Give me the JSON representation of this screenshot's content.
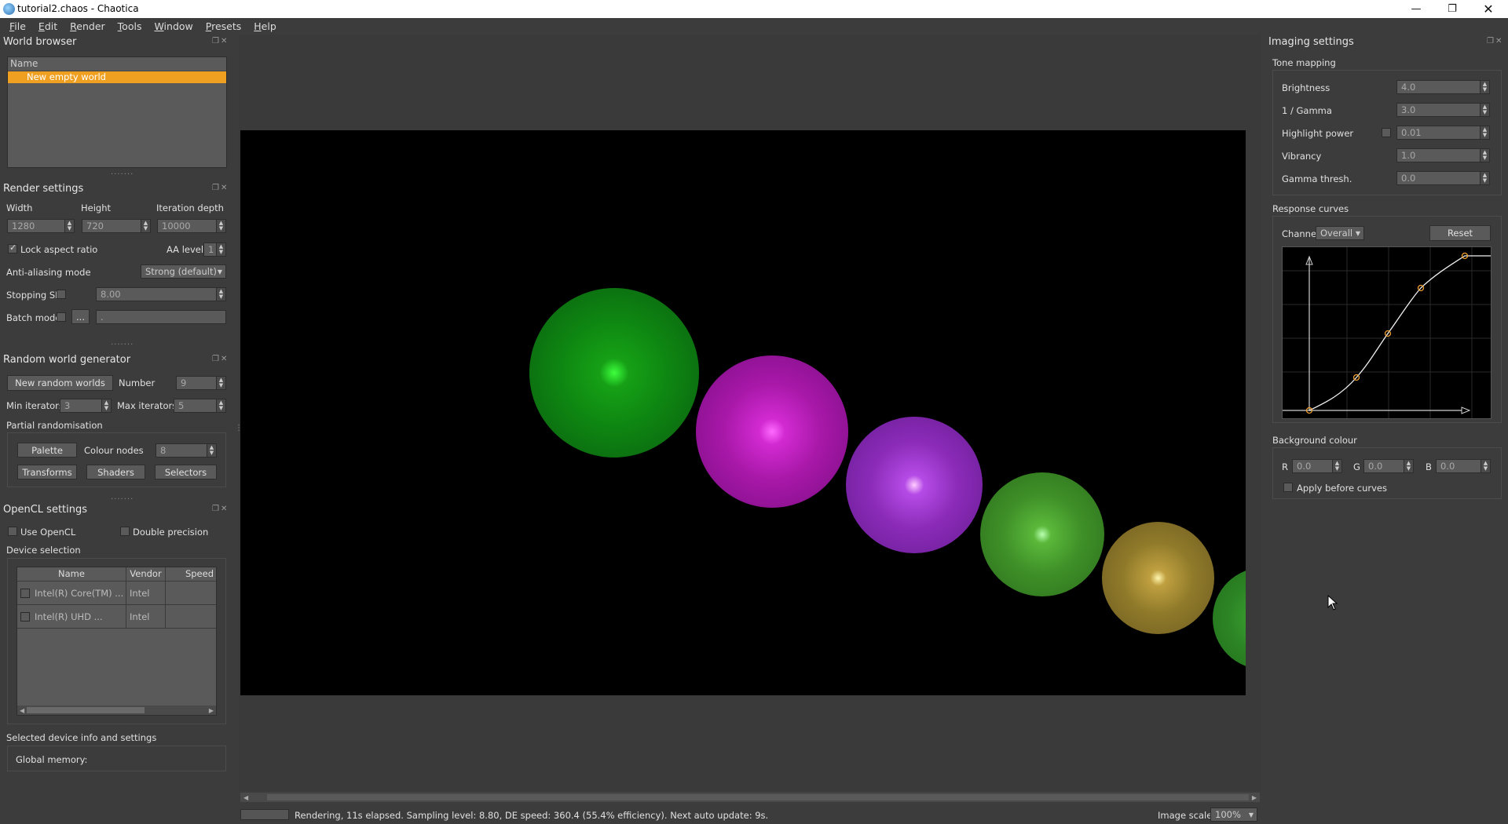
{
  "window": {
    "title": "tutorial2.chaos - Chaotica",
    "minimize_icon": "minimize-icon",
    "maximize_icon": "restore-icon",
    "close_icon": "close-icon"
  },
  "menu": [
    "File",
    "Edit",
    "Render",
    "Tools",
    "Window",
    "Presets",
    "Help"
  ],
  "world_browser": {
    "title": "World browser",
    "column_name": "Name",
    "items": [
      "New empty world"
    ],
    "selected_color": "#f0a020"
  },
  "render_settings": {
    "title": "Render settings",
    "width_label": "Width",
    "height_label": "Height",
    "iteration_depth_label": "Iteration depth",
    "width": "1280",
    "height": "720",
    "iteration_depth": "10000",
    "lock_aspect_label": "Lock aspect ratio",
    "lock_aspect_checked": true,
    "aa_level_label": "AA level",
    "aa_level": "1",
    "anti_aliasing_label": "Anti-aliasing mode",
    "anti_aliasing_value": "Strong (default)",
    "stopping_sl_label": "Stopping SL",
    "stopping_sl_value": "8.00",
    "batch_mode_label": "Batch mode",
    "batch_browse": "...",
    "batch_path": "."
  },
  "random_world": {
    "title": "Random world generator",
    "new_button": "New random worlds",
    "number_label": "Number",
    "number": "9",
    "min_iter_label": "Min iterators",
    "min_iter": "3",
    "max_iter_label": "Max iterators",
    "max_iter": "5",
    "partial_label": "Partial randomisation",
    "palette_button": "Palette",
    "colour_nodes_label": "Colour nodes",
    "colour_nodes": "8",
    "transforms_button": "Transforms",
    "shaders_button": "Shaders",
    "selectors_button": "Selectors"
  },
  "opencl": {
    "title": "OpenCL settings",
    "use_opencl": "Use OpenCL",
    "double_precision": "Double precision",
    "device_selection": "Device selection",
    "columns": [
      "Name",
      "Vendor",
      "Speed"
    ],
    "devices": [
      {
        "name": "Intel(R) Core(TM) ...",
        "vendor": "Intel",
        "speed": ""
      },
      {
        "name": "Intel(R) UHD ...",
        "vendor": "Intel",
        "speed": ""
      }
    ],
    "selected_info": "Selected device info and settings",
    "global_memory": "Global memory:"
  },
  "imaging": {
    "title": "Imaging settings",
    "tone_mapping": "Tone mapping",
    "brightness_label": "Brightness",
    "brightness": "4.0",
    "gamma_label": "1 / Gamma",
    "gamma": "3.0",
    "highlight_label": "Highlight power",
    "highlight": "0.01",
    "vibrancy_label": "Vibrancy",
    "vibrancy": "1.0",
    "gamma_thresh_label": "Gamma thresh.",
    "gamma_thresh": "0.0",
    "response_curves": "Response curves",
    "channel_label": "Channel:",
    "channel_value": "Overall",
    "reset_button": "Reset",
    "background_colour": "Background colour",
    "r_label": "R",
    "r": "0.0",
    "g_label": "G",
    "g": "0.0",
    "b_label": "B",
    "b": "0.0",
    "apply_before_curves": "Apply before curves",
    "curve_color": "#f0a030"
  },
  "status": {
    "text": "Rendering, 11s elapsed. Sampling level: 8.80, DE speed: 360.4 (55.4% efficiency). Next auto update: 9s.",
    "image_scale_label": "Image scale:",
    "image_scale": "100%"
  }
}
